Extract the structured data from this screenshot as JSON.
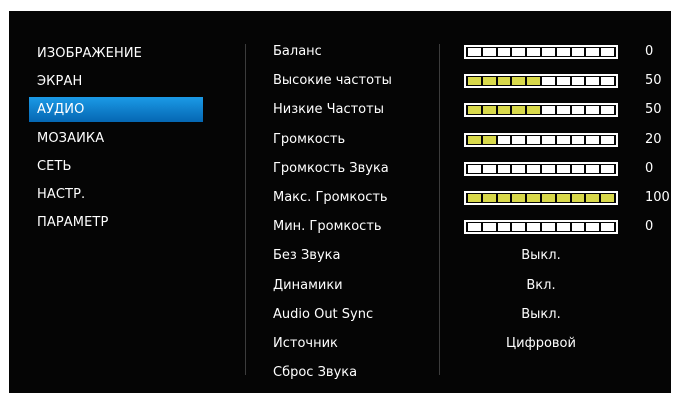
{
  "menu": [
    {
      "label": "ИЗОБРАЖЕНИЕ",
      "selected": false
    },
    {
      "label": "ЭКРАН",
      "selected": false
    },
    {
      "label": "АУДИО",
      "selected": true
    },
    {
      "label": "МОЗАИКА",
      "selected": false
    },
    {
      "label": "СЕТЬ",
      "selected": false
    },
    {
      "label": "НАСТР.",
      "selected": false
    },
    {
      "label": "ПАРАМЕТР",
      "selected": false
    }
  ],
  "settings": [
    {
      "label": "Баланс",
      "kind": "slider",
      "value": "0",
      "level": 0
    },
    {
      "label": "Высокие частоты",
      "kind": "slider",
      "value": "50",
      "level": 0.5
    },
    {
      "label": "Низкие Частоты",
      "kind": "slider",
      "value": "50",
      "level": 0.5
    },
    {
      "label": "Громкость",
      "kind": "slider",
      "value": "20",
      "level": 0.2
    },
    {
      "label": "Громкость Звука",
      "kind": "slider",
      "value": "0",
      "level": 0
    },
    {
      "label": "Макс. Громкость",
      "kind": "slider",
      "value": "100",
      "level": 1.0
    },
    {
      "label": "Мин. Громкость",
      "kind": "slider",
      "value": "0",
      "level": 0
    },
    {
      "label": "Без Звука",
      "kind": "option",
      "value": "Выкл."
    },
    {
      "label": "Динамики",
      "kind": "option",
      "value": "Вкл."
    },
    {
      "label": "Audio Out Sync",
      "kind": "option",
      "value": "Выкл."
    },
    {
      "label": "Источник",
      "kind": "option",
      "value": "Цифровой"
    },
    {
      "label": "Сброс Звука",
      "kind": "action"
    }
  ],
  "colors": {
    "background": "#050505",
    "text": "#ffffff",
    "selection_top": "#1b9ae6",
    "selection_bottom": "#0567b3",
    "slider_fill": "#d8d84a",
    "slider_empty": "#ffffff"
  }
}
